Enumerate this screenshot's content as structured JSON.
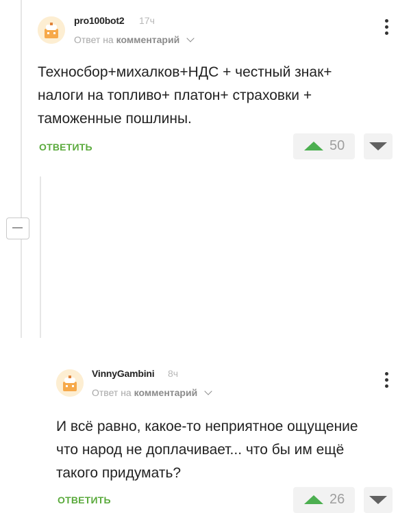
{
  "comments": [
    {
      "username": "pro100bot2",
      "time": "17ч",
      "reply_prefix": "Ответ на",
      "reply_target": "комментарий",
      "text_lines": [
        "Техносбор+михалков+НДС + честный знак+",
        "налоги на топливо+ платон+ страховки +",
        "таможенные пошлины."
      ],
      "reply_label": "ОТВЕТИТЬ",
      "score": "50"
    },
    {
      "username": "VinnyGambini",
      "time": "8ч",
      "reply_prefix": "Ответ на",
      "reply_target": "комментарий",
      "text_lines": [
        "И всё равно, какое-то неприятное ощущение",
        "что народ не доплачивает... что бы им ещё",
        "такого придумать?"
      ],
      "reply_label": "ОТВЕТИТЬ",
      "score": "26"
    }
  ],
  "colors": {
    "accent_green": "#5aaa3c",
    "upvote_green": "#4caf50",
    "downvote_gray": "#616161"
  },
  "icons": [
    "avatar-placeholder-icon",
    "chevron-down-icon",
    "more-vertical-icon",
    "upvote-arrow-icon",
    "downvote-arrow-icon",
    "collapse-thread-icon"
  ]
}
